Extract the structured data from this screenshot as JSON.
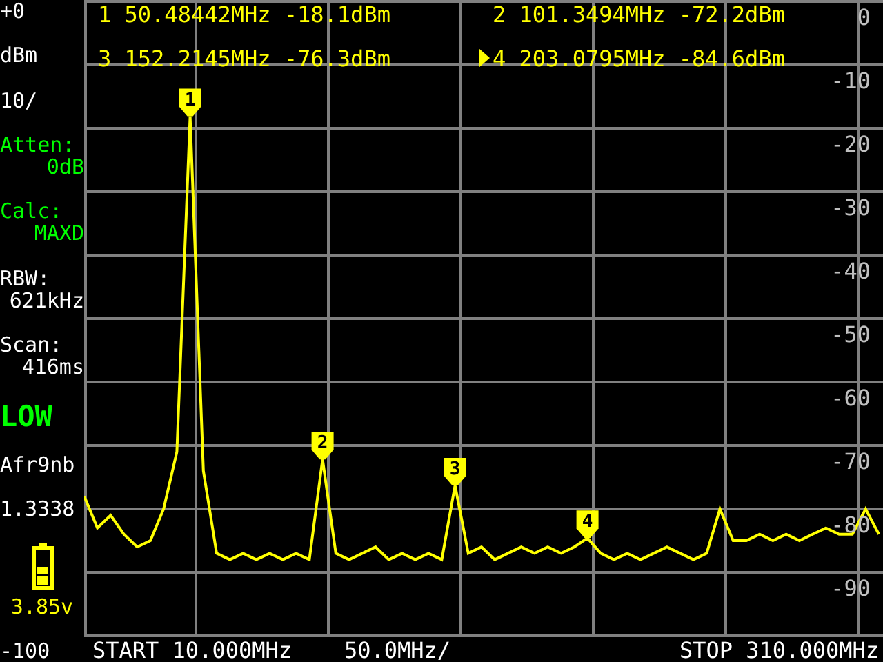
{
  "sidebar": [
    {
      "lines": [
        {
          "text": "+0",
          "color": "#ffffff"
        }
      ]
    },
    {
      "lines": [
        {
          "text": "dBm",
          "color": "#ffffff"
        }
      ]
    },
    {
      "lines": [
        {
          "text": "10/",
          "color": "#ffffff"
        }
      ]
    },
    {
      "lines": [
        {
          "text": "Atten:",
          "color": "#00ff00"
        },
        {
          "text": "0dB",
          "color": "#00ff00"
        }
      ]
    },
    {
      "lines": [
        {
          "text": "Calc:",
          "color": "#00ff00"
        },
        {
          "text": "MAXD",
          "color": "#00ff00"
        }
      ]
    },
    {
      "lines": [
        {
          "text": "RBW:",
          "color": "#ffffff"
        },
        {
          "text": "621kHz",
          "color": "#ffffff"
        }
      ]
    },
    {
      "lines": [
        {
          "text": "Scan:",
          "color": "#ffffff"
        },
        {
          "text": "416ms",
          "color": "#ffffff"
        }
      ]
    },
    {
      "kind": "big",
      "lines": [
        {
          "text": "LOW",
          "color": "#00ff00"
        }
      ]
    },
    {
      "lines": [
        {
          "text": "Afr9nb",
          "color": "#ffffff"
        }
      ]
    },
    {
      "lines": [
        {
          "text": "1.3338",
          "color": "#ffffff"
        }
      ]
    },
    {
      "kind": "battery",
      "lines": [
        {
          "text": "3.85v",
          "color": "#ffff00"
        }
      ]
    },
    {
      "lines": [
        {
          "text": "-100",
          "color": "#ffffff"
        }
      ]
    }
  ],
  "markers": [
    {
      "number": "1",
      "frequency": "50.48442MHz",
      "power": "-18.1dBm",
      "selected": false
    },
    {
      "number": "2",
      "frequency": "101.3494MHz",
      "power": "-72.2dBm",
      "selected": false
    },
    {
      "number": "3",
      "frequency": "152.2145MHz",
      "power": "-76.3dBm",
      "selected": false
    },
    {
      "number": "4",
      "frequency": "203.0795MHz",
      "power": "-84.6dBm",
      "selected": true
    }
  ],
  "chart_data": {
    "type": "line",
    "ylim": [
      -100,
      0
    ],
    "grid": true,
    "yticks": [
      {
        "value": 0,
        "label": "0"
      },
      {
        "value": -10,
        "label": "-10"
      },
      {
        "value": -20,
        "label": "-20"
      },
      {
        "value": -30,
        "label": "-30"
      },
      {
        "value": -40,
        "label": "-40"
      },
      {
        "value": -50,
        "label": "-50"
      },
      {
        "value": -60,
        "label": "-60"
      },
      {
        "value": -70,
        "label": "-70"
      },
      {
        "value": -80,
        "label": "-80"
      },
      {
        "value": -90,
        "label": "-90"
      }
    ],
    "categories": [
      null,
      null,
      null,
      null,
      null,
      null,
      null,
      null,
      null,
      null,
      null,
      null,
      null,
      null,
      null,
      null,
      null,
      null,
      null,
      null,
      null,
      null,
      null,
      null,
      null,
      null,
      null,
      null,
      null,
      null,
      null,
      null,
      null,
      null,
      null,
      null,
      null,
      null,
      null,
      null,
      null,
      null,
      null,
      null,
      null,
      null,
      null,
      null,
      null,
      null,
      null,
      null,
      null,
      null,
      null,
      null,
      null,
      null,
      null,
      null,
      null
    ],
    "series": [
      {
        "color": "#ffff00",
        "values": [
          -78,
          -83,
          -81,
          -84,
          -86,
          -85,
          -80,
          -71,
          -18.1,
          -74,
          -87,
          -88,
          -87,
          -88,
          -87,
          -88,
          -87,
          -88,
          -72.2,
          -87,
          -88,
          -87,
          -86,
          -88,
          -87,
          -88,
          -87,
          -88,
          -76.3,
          -87,
          -86,
          -88,
          -87,
          -86,
          -87,
          -86,
          -87,
          -86,
          -84.6,
          -87,
          -88,
          -87,
          -88,
          -87,
          -86,
          -87,
          -88,
          -87,
          -80,
          -85,
          -85,
          -84,
          -85,
          -84,
          -85,
          -84,
          -83,
          -84,
          -84,
          -80,
          -84
        ]
      }
    ],
    "annotations": [
      {
        "y": -18.1,
        "text": "1"
      },
      {
        "y": -72.2,
        "text": "2"
      },
      {
        "y": -76.3,
        "text": "3"
      },
      {
        "y": -84.6,
        "text": "4"
      }
    ]
  },
  "footer": {
    "start": "START 10.000MHz",
    "scale": "50.0MHz/",
    "stop": "STOP 310.000MHz"
  }
}
